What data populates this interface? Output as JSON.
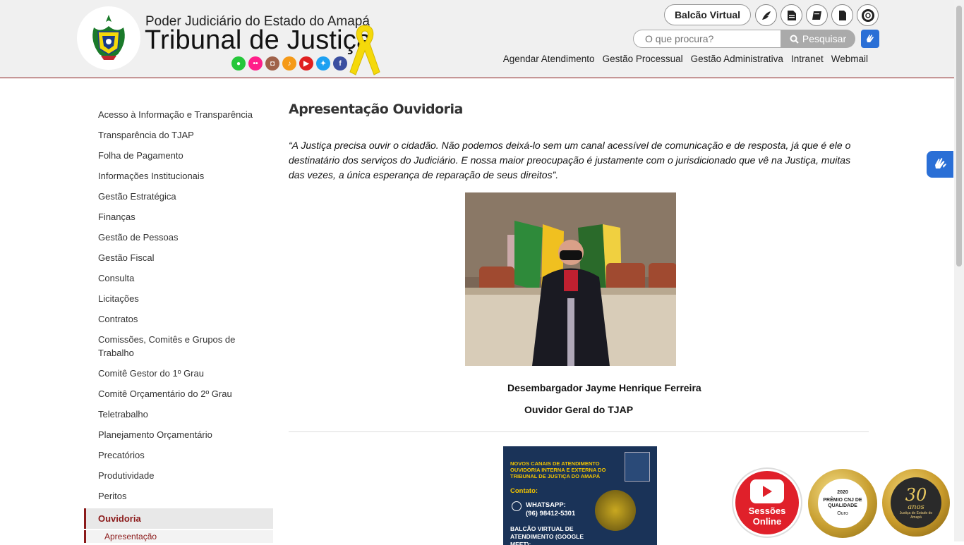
{
  "header": {
    "subtitle": "Poder Judiciário do Estado do Amapá",
    "title": "Tribunal de Justiça",
    "balcao_label": "Balcão Virtual",
    "search_placeholder": "O que procura?",
    "search_button": "Pesquisar",
    "nav": [
      "Agendar Atendimento",
      "Gestão Processual",
      "Gestão Administrativa",
      "Intranet",
      "Webmail"
    ],
    "social_icons": [
      "whatsapp-icon",
      "flickr-icon",
      "instagram-icon",
      "podcast-icon",
      "youtube-icon",
      "twitter-icon",
      "facebook-icon"
    ],
    "tool_icons": [
      "feather-icon",
      "document-icon",
      "book-icon",
      "file-icon",
      "lifebuoy-icon"
    ]
  },
  "sidebar": {
    "items": [
      "Acesso à Informação e Transparência",
      "Transparência do TJAP",
      "Folha de Pagamento",
      "Informações Institucionais",
      "Gestão Estratégica",
      "Finanças",
      "Gestão de Pessoas",
      "Gestão Fiscal",
      "Consulta",
      "Licitações",
      "Contratos",
      "Comissões, Comitês e Grupos de Trabalho",
      "Comitê Gestor do 1º Grau",
      "Comitê Orçamentário do 2º Grau",
      "Teletrabalho",
      "Planejamento Orçamentário",
      "Precatórios",
      "Produtividade",
      "Peritos"
    ],
    "active": "Ouvidoria",
    "active_sub": "Apresentação"
  },
  "content": {
    "title": "Apresentação Ouvidoria",
    "quote": "“A Justiça precisa ouvir o cidadão. Não podemos deixá-lo sem um canal acessível de comunicação e de resposta, já que é ele o destinatário dos serviços do Judiciário. E nossa maior preocupação é justamente com o jurisdicionado que vê na Justiça, muitas das vezes, a única esperança de reparação de seus direitos”.",
    "caption_name": "Desembargador Jayme Henrique Ferreira",
    "caption_role": "Ouvidor Geral do TJAP",
    "banner": {
      "heading": "NOVOS CANAIS DE ATENDIMENTO OUVIDORIA INTERNA E EXTERNA DO TRIBUNAL DE JUSTIÇA DO AMAPÁ",
      "contato": "Contato:",
      "whatsapp_label": "WHATSAPP:",
      "whatsapp_number": "(96) 98412-5301",
      "balcao": "BALCÃO VIRTUAL DE ATENDIMENTO (GOOGLE MEET):"
    }
  },
  "badges": {
    "youtube_line1": "Sessões",
    "youtube_line2": "Online",
    "cnj_year": "2020",
    "cnj_label": "PRÊMIO CNJ DE QUALIDADE",
    "cnj_level": "Ouro",
    "anniv_num": "30",
    "anniv_word": "anos",
    "anniv_caption": "Justiça do Estado do Amapá"
  },
  "colors": {
    "brand": "#8b1a1a",
    "accent_blue": "#2a6fd6",
    "ribbon": "#f5d90a"
  }
}
